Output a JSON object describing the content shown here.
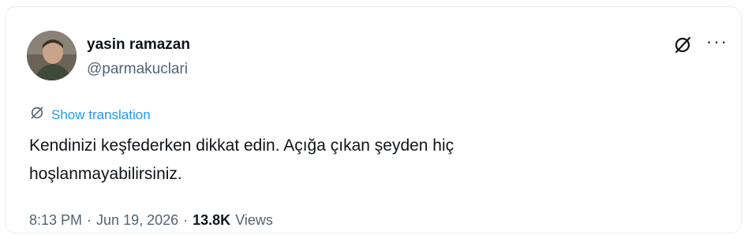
{
  "author": {
    "name": "yasin ramazan",
    "handle": "@parmakuclari"
  },
  "icons": {
    "grok": "slashed-circle-icon",
    "more": "more-horizontal-icon",
    "translate": "translate-icon"
  },
  "more_glyph": "···",
  "translation_label": "Show translation",
  "tweet": {
    "line1": "Kendinizi keşfederken dikkat edin. Açığa çıkan şeyden hiç",
    "line2": "hoşlanmayabilirsiniz."
  },
  "meta": {
    "time": "8:13 PM",
    "separator": "·",
    "date": "Jun 19, 2026",
    "views_count": "13.8K",
    "views_label": "Views"
  },
  "colors": {
    "link": "#1d9bf0",
    "text": "#0f1419",
    "muted": "#536471"
  }
}
